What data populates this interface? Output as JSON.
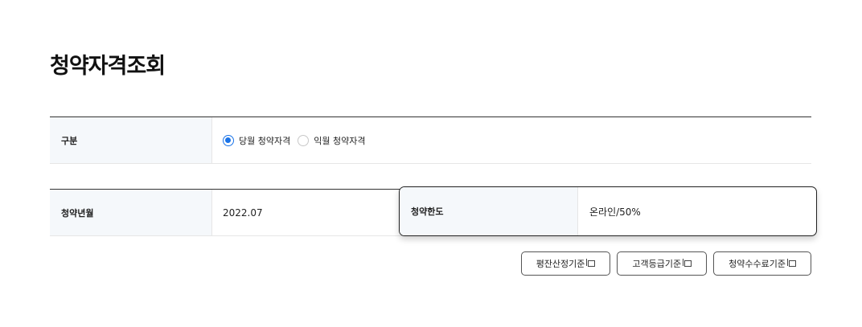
{
  "page": {
    "title": "청약자격조회"
  },
  "category": {
    "label": "구분",
    "options": [
      {
        "label": "당월 청약자격",
        "selected": true
      },
      {
        "label": "익월 청약자격",
        "selected": false
      }
    ]
  },
  "subscription": {
    "month_label": "청약년월",
    "month_value": "2022.07",
    "limit_label": "청약한도",
    "limit_value": "온라인/50%"
  },
  "buttons": {
    "valuation": "평잔산정기준",
    "customer_grade": "고객등급기준",
    "fee": "청약수수료기준"
  },
  "colors": {
    "accent": "#1a73e8",
    "header_bg": "#f5f8fb"
  }
}
